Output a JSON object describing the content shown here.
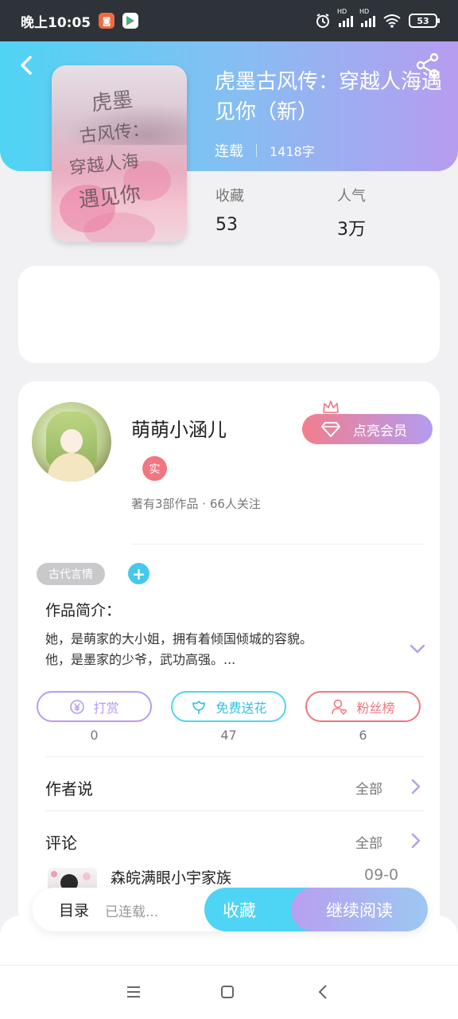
{
  "status_bar": {
    "time": "晚上10:05",
    "network_label": "HD",
    "battery": "53"
  },
  "book": {
    "title": "虎墨古风传：穿越人海遇见你（新）",
    "status": "连载",
    "word_count": "1418字",
    "cover_text_line1": "虎墨",
    "cover_text_line2": "古风传：",
    "cover_text_line3": "穿越人海",
    "cover_text_line4": "遇见你",
    "stats": {
      "favorites_label": "收藏",
      "favorites_value": "53",
      "popularity_label": "人气",
      "popularity_value": "3万"
    }
  },
  "author": {
    "name": "萌萌小涵儿",
    "verified_badge": "实",
    "meta": "著有3部作品 · 66人关注",
    "member_button": "点亮会员"
  },
  "tags": {
    "genre": "古代言情",
    "add_symbol": "+"
  },
  "intro": {
    "heading": "作品简介：",
    "line1": "她，是萌家的大小姐，拥有着倾国倾城的容貌。",
    "line2": "他，是墨家的少爷，武功高强。..."
  },
  "actions": [
    {
      "label": "打赏",
      "count": "0"
    },
    {
      "label": "免费送花",
      "count": "47"
    },
    {
      "label": "粉丝榜",
      "count": "6"
    }
  ],
  "sections": {
    "author_says": "作者说",
    "author_says_all": "全部",
    "comments": "评论",
    "comments_all": "全部"
  },
  "comment": {
    "user": "森皖满眼小宇家族",
    "date": "09-0"
  },
  "bottom": {
    "toc": "目录",
    "toc_status": "已连载...",
    "collect": "收藏",
    "continue": "继续阅读"
  },
  "colors": {
    "accent_cyan": "#4ed4f4",
    "accent_purple": "#b79cf0",
    "reward_border": "#b79cf0",
    "flower_border": "#4ed4f4",
    "fans_border": "#f07680"
  }
}
